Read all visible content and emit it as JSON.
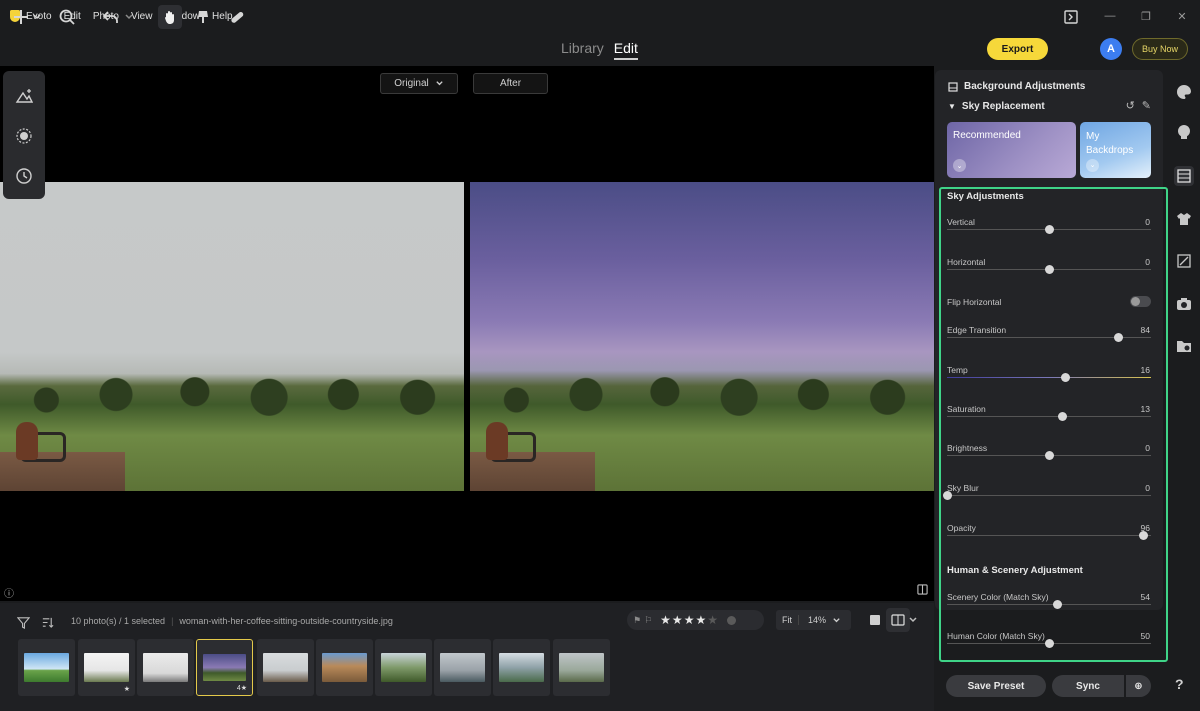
{
  "app": {
    "name": "Evoto",
    "menu": [
      "Edit",
      "Photo",
      "View",
      "Window",
      "Help"
    ]
  },
  "toolbar": {
    "modes": {
      "library": "Library",
      "edit": "Edit"
    },
    "export_label": "Export",
    "avatar_letter": "A",
    "buy_label": "Buy Now"
  },
  "canvas": {
    "original_label": "Original",
    "after_label": "After"
  },
  "panel": {
    "title": "Background Adjustments",
    "section": "Sky Replacement",
    "cards": {
      "recommended": "Recommended",
      "my_backdrops": "My Backdrops"
    },
    "sky_adjustments_title": "Sky Adjustments",
    "sliders": [
      {
        "label": "Vertical",
        "value": "0",
        "fraction": 0.5
      },
      {
        "label": "Horizontal",
        "value": "0",
        "fraction": 0.5
      },
      {
        "label": "Edge Transition",
        "value": "84",
        "fraction": 0.84
      },
      {
        "label": "Temp",
        "value": "16",
        "fraction": 0.58
      },
      {
        "label": "Saturation",
        "value": "13",
        "fraction": 0.565
      },
      {
        "label": "Brightness",
        "value": "0",
        "fraction": 0.5
      },
      {
        "label": "Sky Blur",
        "value": "0",
        "fraction": 0.0
      },
      {
        "label": "Opacity",
        "value": "96",
        "fraction": 0.96
      }
    ],
    "flip_horizontal_label": "Flip Horizontal",
    "flip_horizontal_on": false,
    "human_scenery_title": "Human & Scenery Adjustment",
    "human_sliders": [
      {
        "label": "Scenery Color (Match Sky)",
        "value": "54",
        "fraction": 0.54
      },
      {
        "label": "Human Color (Match Sky)",
        "value": "50",
        "fraction": 0.5
      }
    ],
    "save_preset_label": "Save Preset",
    "sync_label": "Sync"
  },
  "filmstrip": {
    "count_text": "10 photo(s) / 1 selected",
    "filename": "woman-with-her-coffee-sitting-outside-countryside.jpg",
    "rating": 4,
    "fit_label": "Fit",
    "zoom": "14%",
    "thumb_badges": [
      "",
      "★",
      "",
      "4★",
      "",
      "",
      "",
      "",
      "",
      ""
    ]
  },
  "colors": {
    "accent_yellow": "#f6d83a",
    "highlight_green": "#3fd488",
    "avatar_blue": "#3c7df0"
  }
}
